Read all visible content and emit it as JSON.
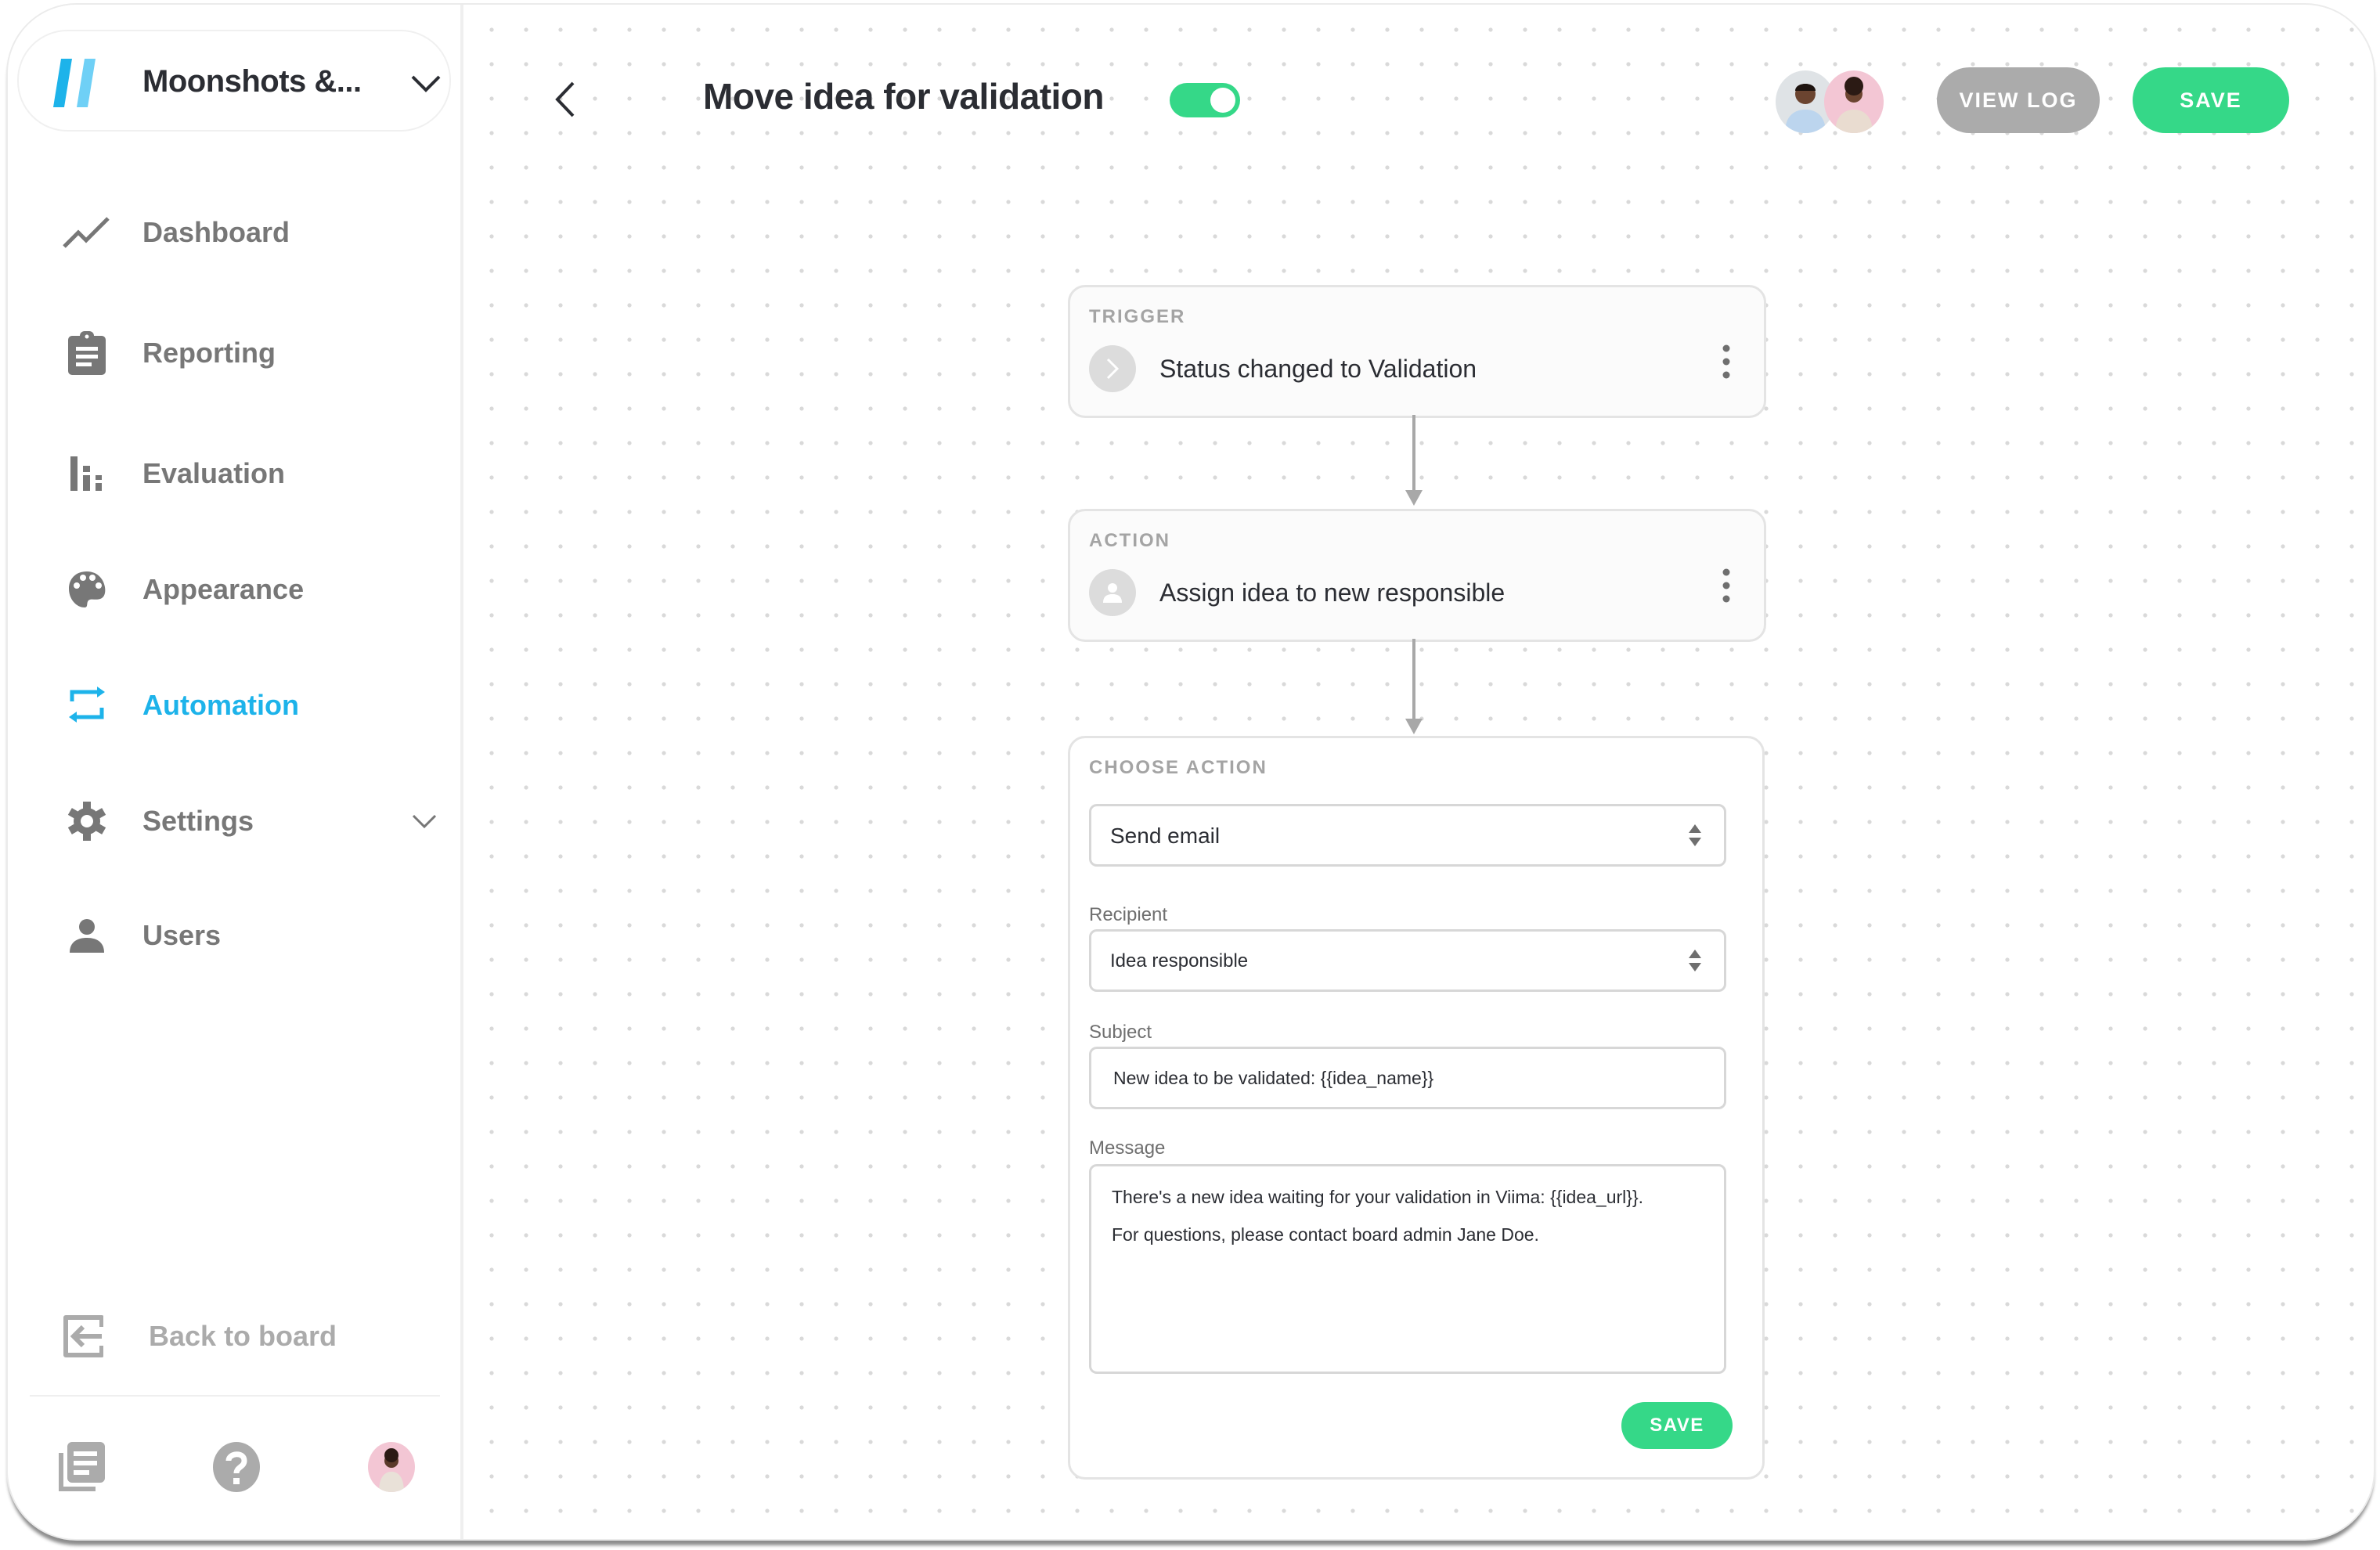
{
  "workspace": {
    "name": "Moonshots &...",
    "logo_colors": [
      "#1db3ea",
      "#6fd0f6"
    ]
  },
  "sidebar": {
    "items": [
      {
        "label": "Dashboard",
        "icon": "trend-line-icon",
        "active": false
      },
      {
        "label": "Reporting",
        "icon": "clipboard-icon",
        "active": false
      },
      {
        "label": "Evaluation",
        "icon": "bar-chart-icon",
        "active": false
      },
      {
        "label": "Appearance",
        "icon": "palette-icon",
        "active": false
      },
      {
        "label": "Automation",
        "icon": "repeat-icon",
        "active": true
      },
      {
        "label": "Settings",
        "icon": "gear-icon",
        "active": false,
        "expandable": true
      },
      {
        "label": "Users",
        "icon": "user-icon",
        "active": false
      }
    ],
    "back_to_board": "Back to board",
    "bottom_icons": [
      "documents-icon",
      "help-icon",
      "user-avatar"
    ]
  },
  "header": {
    "title": "Move idea for validation",
    "enabled": true,
    "view_log_label": "VIEW LOG",
    "save_label": "SAVE",
    "collaborators": [
      "collaborator-avatar-1",
      "collaborator-avatar-2"
    ]
  },
  "flow": {
    "trigger": {
      "kicker": "TRIGGER",
      "title": "Status changed to Validation",
      "icon": "chevron-right-icon"
    },
    "action": {
      "kicker": "ACTION",
      "title": "Assign idea to new responsible",
      "icon": "person-icon"
    },
    "choose_action": {
      "kicker": "CHOOSE ACTION",
      "action_select": "Send email",
      "recipient_label": "Recipient",
      "recipient_value": "Idea responsible",
      "subject_label": "Subject",
      "subject_value": "New idea to be validated: {{idea_name}}",
      "message_label": "Message",
      "message_lines": [
        "There's a new idea waiting for your validation in Viima: {{idea_url}}.",
        "For questions, please contact board admin Jane Doe."
      ],
      "save_label": "SAVE"
    }
  },
  "colors": {
    "accent": "#1db3ea",
    "success": "#35d888",
    "muted": "#ababab",
    "text": "#2b2d33"
  }
}
